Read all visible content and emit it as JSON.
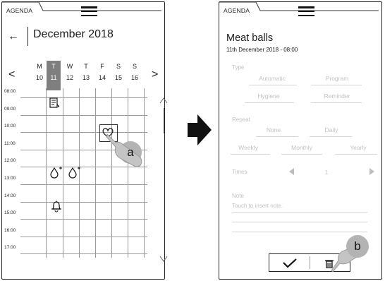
{
  "left_screen": {
    "tab_label": "AGENDA",
    "month_title": "December 2018",
    "back_glyph": "←",
    "prev_glyph": "<",
    "next_glyph": ">",
    "days": [
      {
        "letter": "M",
        "num": "10"
      },
      {
        "letter": "T",
        "num": "11",
        "selected": true
      },
      {
        "letter": "W",
        "num": "12"
      },
      {
        "letter": "T",
        "num": "13"
      },
      {
        "letter": "F",
        "num": "14"
      },
      {
        "letter": "S",
        "num": "15"
      },
      {
        "letter": "S",
        "num": "16"
      }
    ],
    "hours": [
      "08:00",
      "09:00",
      "10:00",
      "11:00",
      "12:00",
      "13:00",
      "14:00",
      "15:00",
      "16:00",
      "17:00"
    ],
    "events": [
      {
        "icon": "program-sheet-icon",
        "glyph": "▤"
      },
      {
        "icon": "hygiene-heart-icon",
        "glyph": "♡"
      },
      {
        "icon": "water-drop-plus-icon",
        "glyph": "💧"
      },
      {
        "icon": "water-drop-plus-icon",
        "glyph": "💧"
      },
      {
        "icon": "bell-icon",
        "glyph": "🔔"
      }
    ],
    "callout": "a"
  },
  "right_screen": {
    "tab_label": "AGENDA",
    "title": "Meat balls",
    "subtitle": "11th December 2018 - 08:00",
    "type_label": "Type",
    "type_options": [
      "Automatic",
      "Program",
      "Hygiene",
      "Reminder"
    ],
    "repeat_label": "Repeat",
    "repeat_options": [
      "None",
      "Daily",
      "Weekly",
      "Monthly",
      "Yearly"
    ],
    "times_label": "Times",
    "times_value": "1",
    "note_label": "Note",
    "note_placeholder": "Touch to insert note.",
    "confirm_glyph": "✓",
    "delete_glyph": "🗑",
    "callout": "b"
  },
  "colors": {
    "selected_day": "#7f7f7f",
    "disabled_text": "#c2c2c2",
    "callout_bubble": "#b3b3b3"
  }
}
